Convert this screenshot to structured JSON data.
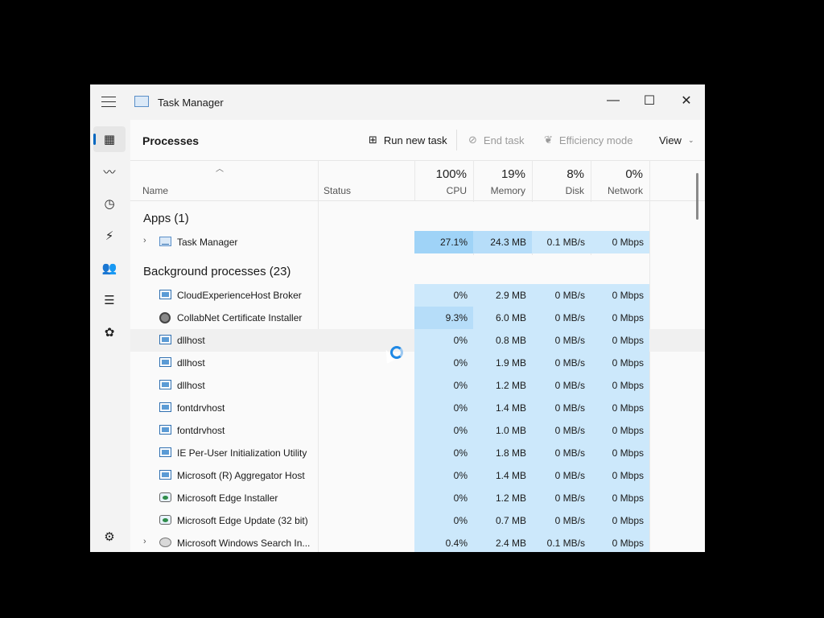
{
  "window": {
    "title": "Task Manager"
  },
  "window_controls": {
    "minimize": "—",
    "maximize": "☐",
    "close": "✕"
  },
  "sidebar": {
    "items": [
      "processes",
      "performance",
      "app-history",
      "startup-apps",
      "users",
      "details",
      "services",
      "settings"
    ]
  },
  "toolbar": {
    "page_title": "Processes",
    "run_new_task": "Run new task",
    "end_task": "End task",
    "efficiency_mode": "Efficiency mode",
    "view": "View"
  },
  "columns": {
    "name": "Name",
    "status": "Status",
    "cpu": {
      "pct": "100%",
      "label": "CPU"
    },
    "memory": {
      "pct": "19%",
      "label": "Memory"
    },
    "disk": {
      "pct": "8%",
      "label": "Disk"
    },
    "network": {
      "pct": "0%",
      "label": "Network"
    }
  },
  "groups": {
    "apps": "Apps (1)",
    "background": "Background processes (23)"
  },
  "apps": [
    {
      "name": "Task Manager",
      "cpu": "27.1%",
      "memory": "24.3 MB",
      "disk": "0.1 MB/s",
      "network": "0 Mbps"
    }
  ],
  "background": [
    {
      "name": "CloudExperienceHost Broker",
      "cpu": "0%",
      "memory": "2.9 MB",
      "disk": "0 MB/s",
      "network": "0 Mbps"
    },
    {
      "name": "CollabNet Certificate Installer",
      "cpu": "9.3%",
      "memory": "6.0 MB",
      "disk": "0 MB/s",
      "network": "0 Mbps"
    },
    {
      "name": "dllhost",
      "cpu": "0%",
      "memory": "0.8 MB",
      "disk": "0 MB/s",
      "network": "0 Mbps"
    },
    {
      "name": "dllhost",
      "cpu": "0%",
      "memory": "1.9 MB",
      "disk": "0 MB/s",
      "network": "0 Mbps"
    },
    {
      "name": "dllhost",
      "cpu": "0%",
      "memory": "1.2 MB",
      "disk": "0 MB/s",
      "network": "0 Mbps"
    },
    {
      "name": "fontdrvhost",
      "cpu": "0%",
      "memory": "1.4 MB",
      "disk": "0 MB/s",
      "network": "0 Mbps"
    },
    {
      "name": "fontdrvhost",
      "cpu": "0%",
      "memory": "1.0 MB",
      "disk": "0 MB/s",
      "network": "0 Mbps"
    },
    {
      "name": "IE Per-User Initialization Utility",
      "cpu": "0%",
      "memory": "1.8 MB",
      "disk": "0 MB/s",
      "network": "0 Mbps"
    },
    {
      "name": "Microsoft (R) Aggregator Host",
      "cpu": "0%",
      "memory": "1.4 MB",
      "disk": "0 MB/s",
      "network": "0 Mbps"
    },
    {
      "name": "Microsoft Edge Installer",
      "cpu": "0%",
      "memory": "1.2 MB",
      "disk": "0 MB/s",
      "network": "0 Mbps"
    },
    {
      "name": "Microsoft Edge Update (32 bit)",
      "cpu": "0%",
      "memory": "0.7 MB",
      "disk": "0 MB/s",
      "network": "0 Mbps"
    },
    {
      "name": "Microsoft Windows Search In...",
      "cpu": "0.4%",
      "memory": "2.4 MB",
      "disk": "0.1 MB/s",
      "network": "0 Mbps"
    }
  ],
  "colors": {
    "heat_light": "#cce8fb",
    "heat_strong": "#9fd3f7",
    "heat_mid": "#b6ddf9",
    "accent": "#0067c0"
  }
}
